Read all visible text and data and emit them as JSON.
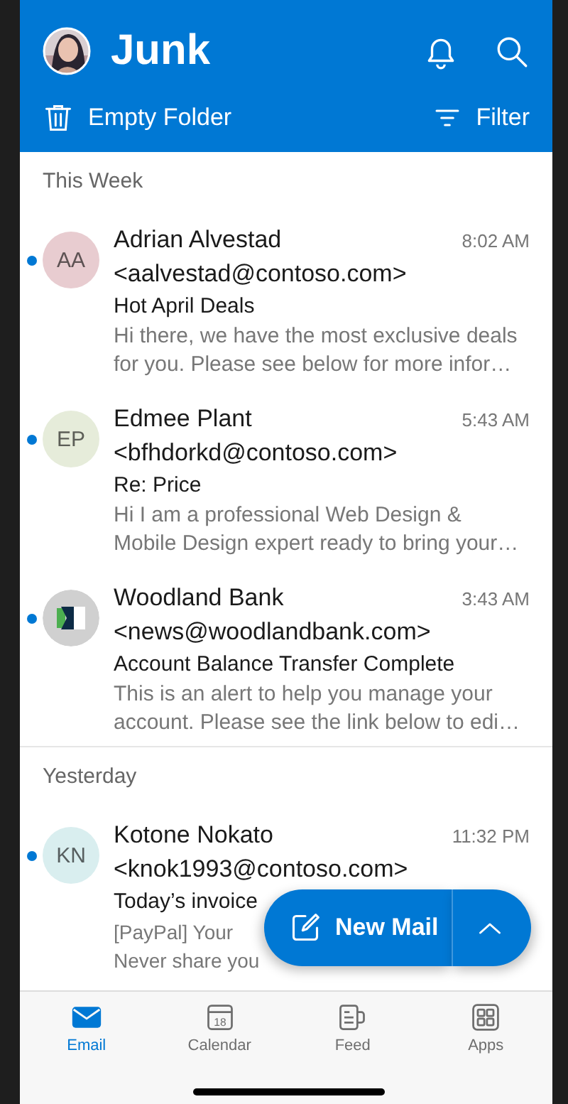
{
  "header": {
    "title": "Junk"
  },
  "actions": {
    "empty": "Empty Folder",
    "filter": "Filter"
  },
  "sections": [
    {
      "title": "This Week",
      "messages": [
        {
          "sender": "Adrian Alvestad",
          "email": "<aalvestad@contoso.com>",
          "time": "8:02 AM",
          "subject": "Hot April Deals",
          "preview": "Hi there, we have the most exclusive deals for you. Please see below for more infor…",
          "unread": true,
          "avatar": {
            "kind": "initials",
            "initials": "AA",
            "color": "#e8ccd0"
          }
        },
        {
          "sender": "Edmee Plant",
          "email": "<bfhdorkd@contoso.com>",
          "time": "5:43 AM",
          "subject": "Re: Price",
          "preview": "Hi I am a professional Web Design & Mobile Design expert ready to bring your…",
          "unread": true,
          "avatar": {
            "kind": "initials",
            "initials": "EP",
            "color": "#e6ecda"
          }
        },
        {
          "sender": "Woodland Bank",
          "email": "<news@woodlandbank.com>",
          "time": "3:43 AM",
          "subject": "Account Balance Transfer Complete",
          "preview": "This is an alert to help you manage your account. Please see the link below to edi…",
          "unread": true,
          "avatar": {
            "kind": "logo",
            "color": "#d0d0d0"
          }
        }
      ]
    },
    {
      "title": "Yesterday",
      "messages": [
        {
          "sender": "Kotone Nokato",
          "email": "<knok1993@contoso.com>",
          "time": "11:32 PM",
          "subject": "Today’s invoice",
          "preview_lines": [
            "[PayPal] Your",
            "Never share you"
          ],
          "unread": true,
          "avatar": {
            "kind": "initials",
            "initials": "KN",
            "color": "#d9eeef"
          }
        }
      ]
    }
  ],
  "fab": {
    "label": "New Mail"
  },
  "tabs": [
    {
      "label": "Email",
      "kind": "mail",
      "selected": true
    },
    {
      "label": "Calendar",
      "kind": "calendar",
      "day": "18",
      "selected": false
    },
    {
      "label": "Feed",
      "kind": "feed",
      "selected": false
    },
    {
      "label": "Apps",
      "kind": "apps",
      "selected": false
    }
  ]
}
